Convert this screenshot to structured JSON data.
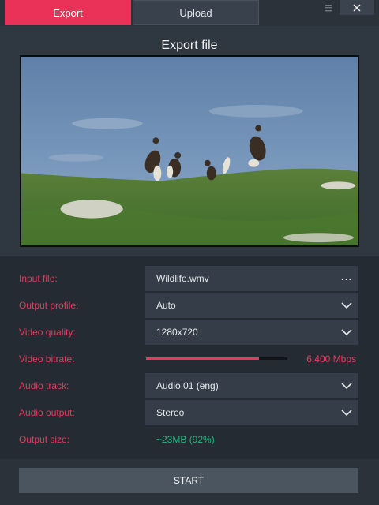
{
  "tabs": {
    "export": "Export",
    "upload": "Upload"
  },
  "title": "Export file",
  "settings": {
    "input_file": {
      "label": "Input file:",
      "value": "Wildlife.wmv",
      "action": "..."
    },
    "output_profile": {
      "label": "Output profile:",
      "value": "Auto"
    },
    "video_quality": {
      "label": "Video quality:",
      "value": "1280x720"
    },
    "video_bitrate": {
      "label": "Video bitrate:",
      "value": "6.400 Mbps",
      "fraction": 0.8
    },
    "audio_track": {
      "label": "Audio track:",
      "value": "Audio 01 (eng)"
    },
    "audio_output": {
      "label": "Audio output:",
      "value": "Stereo"
    },
    "output_size": {
      "label": "Output size:",
      "value": "~23MB (92%)"
    }
  },
  "start_label": "START",
  "icons": {
    "minimize": "minimize-icon",
    "close": "close-icon",
    "dropdown": "chevron-down-icon"
  },
  "colors": {
    "accent": "#ea3157",
    "label": "#e83a5f",
    "success": "#1eb77c",
    "background": "#2b323a"
  }
}
